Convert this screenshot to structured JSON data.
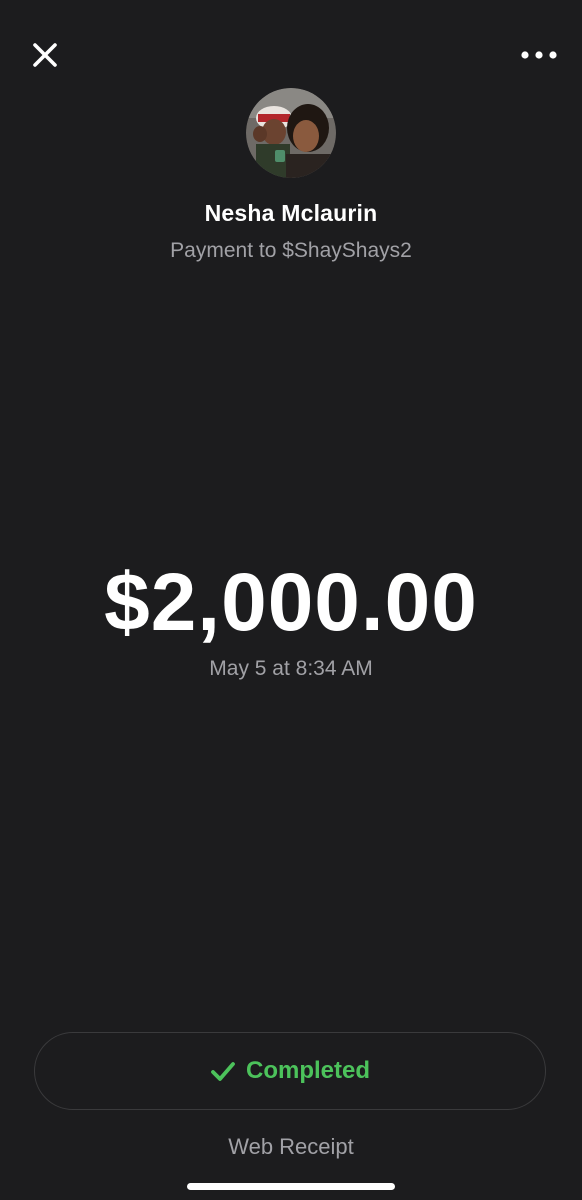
{
  "header": {
    "close_icon": "close-icon",
    "more_icon": "more-horizontal-icon"
  },
  "recipient": {
    "avatar_icon": "profile-photo",
    "name": "Nesha Mclaurin",
    "subtitle": "Payment to $ShayShays2"
  },
  "payment": {
    "amount": "$2,000.00",
    "timestamp": "May 5 at 8:34 AM"
  },
  "status": {
    "icon": "checkmark-icon",
    "label": "Completed",
    "color": "#4cc25b"
  },
  "footer": {
    "web_receipt_label": "Web Receipt"
  },
  "colors": {
    "background": "#1c1c1e",
    "primary_text": "#ffffff",
    "secondary_text": "#a1a1a6",
    "pill_border": "#3a3a3c"
  }
}
